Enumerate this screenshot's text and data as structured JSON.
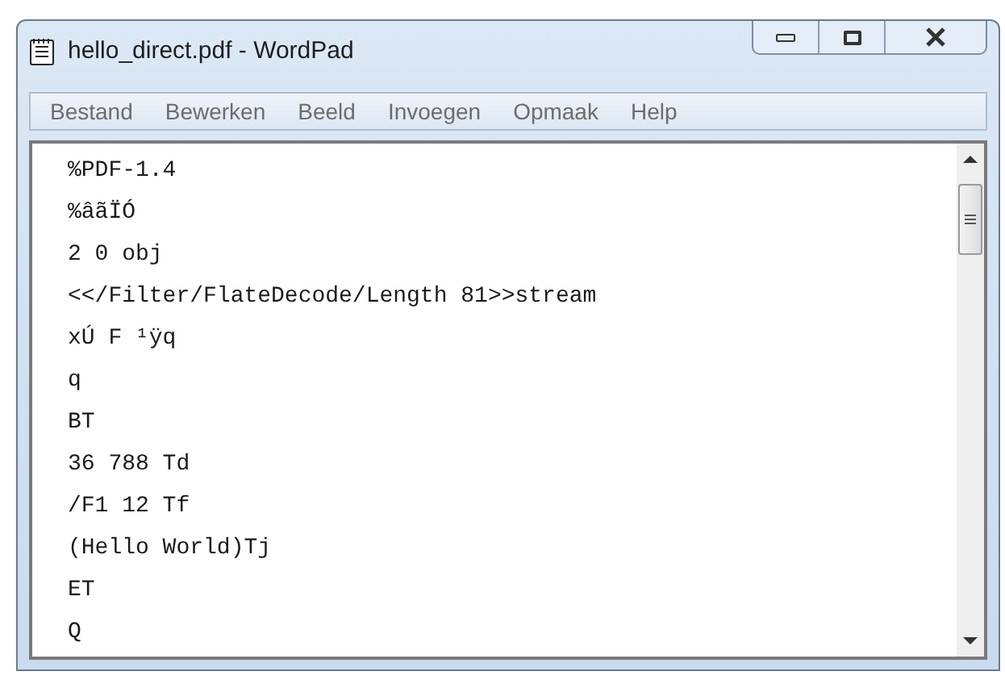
{
  "window": {
    "title": "hello_direct.pdf - WordPad"
  },
  "menu": [
    "Bestand",
    "Bewerken",
    "Beeld",
    "Invoegen",
    "Opmaak",
    "Help"
  ],
  "document": {
    "lines": [
      "%PDF-1.4",
      "%âãÏÓ",
      "2 0 obj",
      "<</Filter/FlateDecode/Length 81>>stream",
      "xÚ F ¹ÿq",
      "q",
      "BT",
      "36 788 Td",
      "/F1 12 Tf",
      "(Hello World)Tj",
      "ET",
      "Q"
    ]
  }
}
